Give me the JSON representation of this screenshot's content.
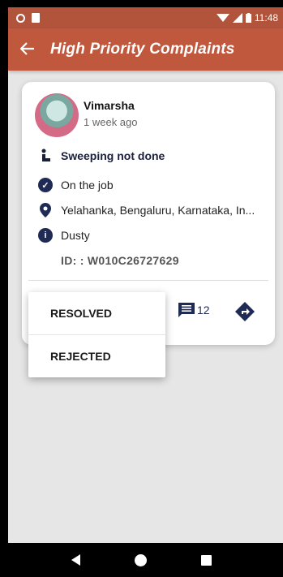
{
  "status_bar": {
    "time": "11:48"
  },
  "app_bar": {
    "back_icon": "arrow-left-icon",
    "title": "High Priority Complaints"
  },
  "complaint": {
    "user_name": "Vimarsha",
    "posted": "1 week ago",
    "title": "Sweeping not done",
    "status": "On the job",
    "location": "Yelahanka, Bengaluru, Karnataka, In...",
    "category": "Dusty",
    "id": "ID: : W010C26727629",
    "comment_count": "12"
  },
  "menu": {
    "items": [
      "RESOLVED",
      "REJECTED"
    ]
  },
  "colors": {
    "accent": "#c0583e",
    "navy": "#1f2a55"
  }
}
